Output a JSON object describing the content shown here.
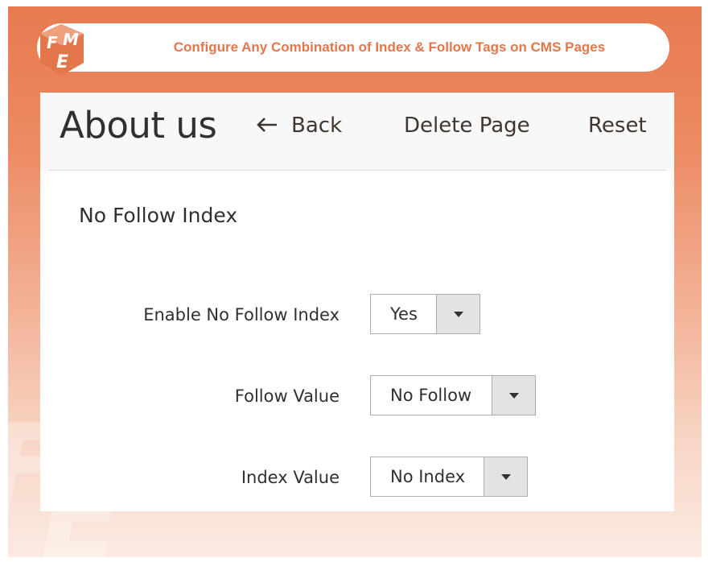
{
  "banner": {
    "logo": "FME",
    "title": "Configure Any Combination of Index & Follow Tags on CMS Pages"
  },
  "header": {
    "page_title": "About us",
    "back_label": "Back",
    "back_icon": "left-arrow-icon",
    "delete_label": "Delete Page",
    "reset_label": "Reset"
  },
  "section": {
    "title": "No Follow Index"
  },
  "fields": [
    {
      "label": "Enable No Follow Index",
      "value": "Yes"
    },
    {
      "label": "Follow Value",
      "value": "No Follow"
    },
    {
      "label": "Index Value",
      "value": "No Index"
    }
  ],
  "colors": {
    "accent": "#e3764b",
    "frame_top": "#e87a4f",
    "dropdown_button": "#e3e3e3"
  }
}
